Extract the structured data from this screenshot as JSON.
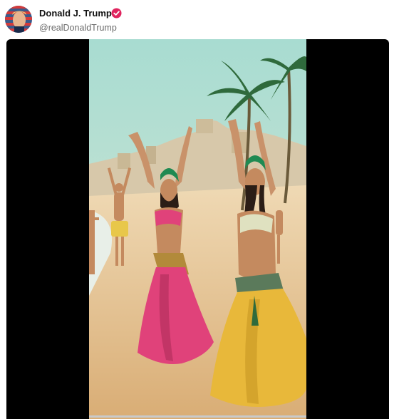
{
  "post": {
    "author": {
      "display_name": "Donald J. Trump",
      "handle": "@realDonaldTrump",
      "verified": true
    },
    "media": {
      "type": "video",
      "progress": 0.0
    }
  },
  "colors": {
    "verified_badge": "#e0245e",
    "video_letterbox": "#000000",
    "sky": "#a8dcd1",
    "sand": "#e7c89a",
    "pink_skirt": "#e0427a",
    "yellow_skirt": "#e8b83a",
    "green_hat": "#1f8a52"
  },
  "icons": {
    "avatar": "profile-avatar",
    "badge": "verified-badge-icon"
  }
}
